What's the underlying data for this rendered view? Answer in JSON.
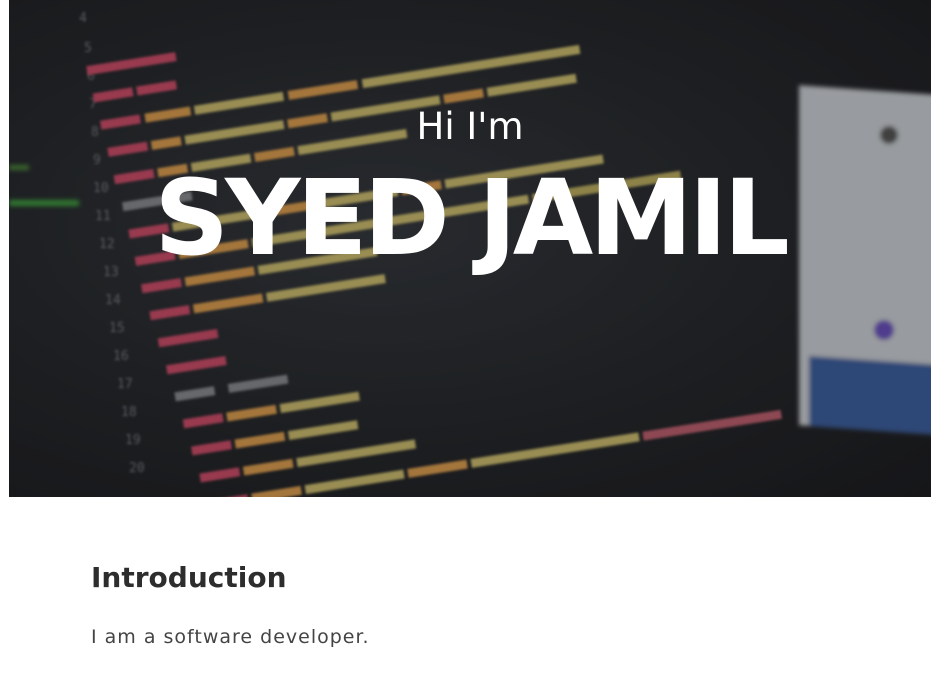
{
  "hero": {
    "greeting": "Hi I'm",
    "name": "SYED JAMIL",
    "background": "code-editor-photo"
  },
  "introduction": {
    "title": "Introduction",
    "text": "I am a software developer."
  },
  "colors": {
    "hero_text": "#ffffff",
    "hero_dark": "#24262a",
    "heading": "#2d2d2d",
    "body_text": "#444444"
  }
}
